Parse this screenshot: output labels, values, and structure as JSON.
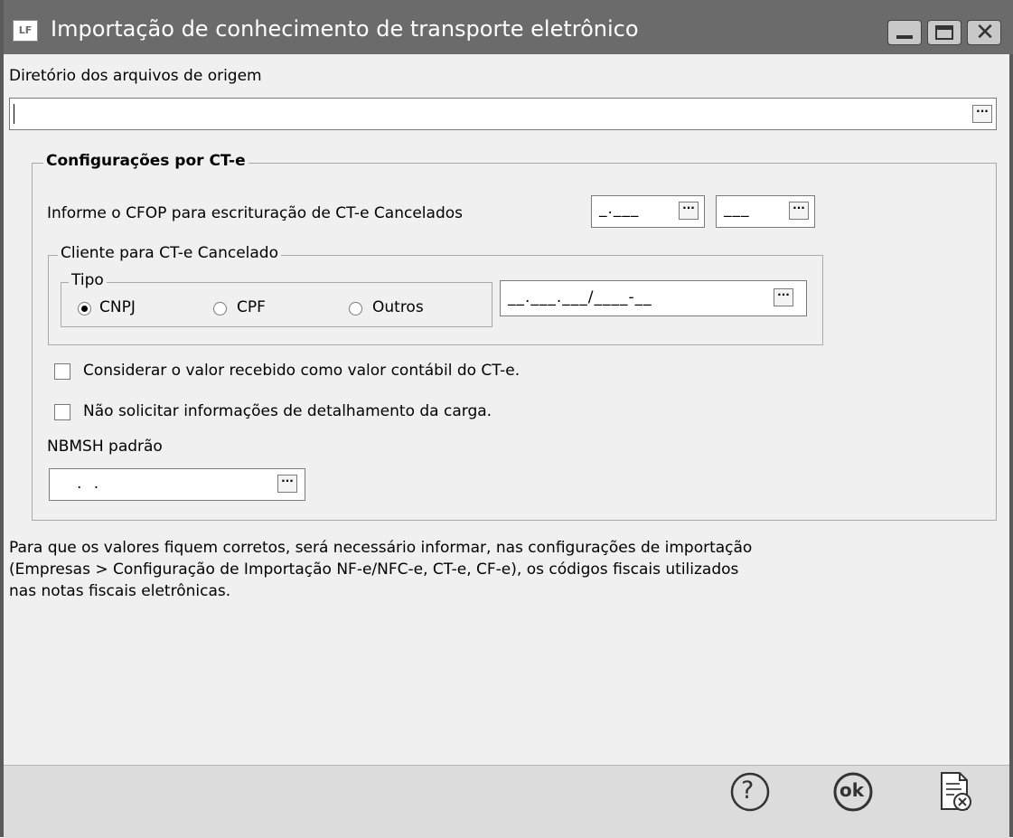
{
  "window": {
    "title": "Importação de conhecimento de transporte eletrônico",
    "app_icon_text": "LF"
  },
  "source_dir": {
    "label": "Diretório dos arquivos de origem",
    "value": ""
  },
  "config_group": {
    "title": "Configurações por CT-e",
    "cfop_label": "Informe o CFOP para escrituração de CT-e Cancelados",
    "cfop_mask_1": "_.___",
    "cfop_mask_2": "___",
    "client_group": {
      "title": "Cliente para CT-e Cancelado",
      "tipo_group": {
        "title": "Tipo",
        "options": [
          "CNPJ",
          "CPF",
          "Outros"
        ],
        "selected": "CNPJ"
      },
      "doc_mask": "__.___.___/____-__"
    },
    "checkbox_1": {
      "label": "Considerar o valor recebido como valor contábil do CT-e.",
      "checked": false
    },
    "checkbox_2": {
      "label": "Não solicitar informações de detalhamento da carga.",
      "checked": false
    },
    "nbmsh_label": "NBMSH padrão",
    "nbmsh_mask": ". ."
  },
  "info_text": {
    "line1": "Para que os valores fiquem corretos, será necessário informar, nas configurações de importação",
    "line2": "(Empresas > Configuração de Importação NF-e/NFC-e, CT-e, CF-e), os códigos fiscais utilizados",
    "line3": "nas notas fiscais eletrônicas."
  },
  "buttons": {
    "ellipsis": "···",
    "ok_text": "ok",
    "help_text": "?"
  },
  "colors": {
    "titlebar": "#6b6b6b",
    "background": "#f0f0f0",
    "bottombar": "#dcdcdc"
  },
  "icons": [
    "help-icon",
    "ok-icon",
    "cancel-document-icon",
    "minimize-icon",
    "maximize-icon",
    "close-icon"
  ]
}
